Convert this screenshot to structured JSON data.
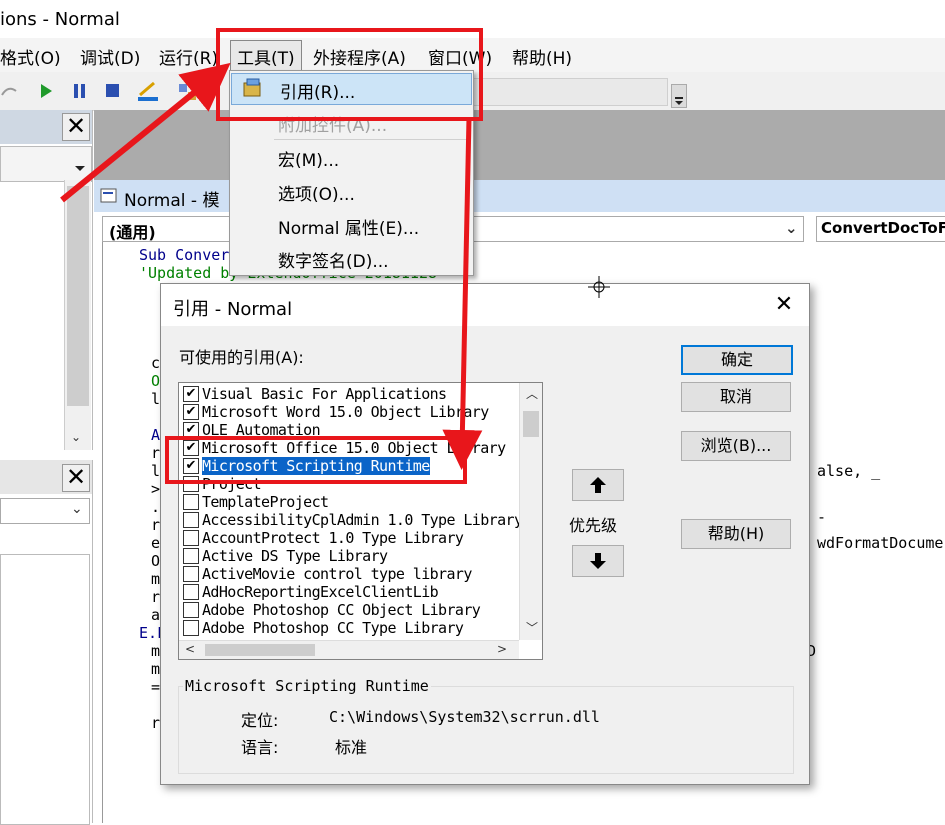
{
  "window": {
    "title": "ions - Normal"
  },
  "menubar": {
    "items": [
      "格式(O)",
      "调试(D)",
      "运行(R)",
      "工具(T)",
      "外接程序(A)",
      "窗口(W)",
      "帮助(H)"
    ]
  },
  "left_panes": {
    "top_close": "✕",
    "bottom_close": "✕"
  },
  "code_window": {
    "title": "Normal - 模",
    "left_combo": "(通用)",
    "right_combo": "ConvertDocToF",
    "lines": [
      "Sub Conver",
      "'Updated by ExtendOffice 20181128",
      "c",
      "O",
      "l",
      "A",
      "r",
      "l",
      ">",
      ".",
      "r",
      "e",
      "O",
      "m",
      "r",
      "a",
      "E.F",
      "m",
      "m",
      "=",
      "r"
    ],
    "right_fragments": [
      "alse, _",
      "-",
      "wdFormatDocumer",
      "D"
    ]
  },
  "tools_menu": {
    "items": [
      {
        "label": "引用(R)...",
        "state": "selected",
        "icon": "references-icon"
      },
      {
        "label": "附加控件(A)...",
        "state": "disabled"
      },
      {
        "label": "宏(M)...",
        "state": "normal"
      },
      {
        "label": "选项(O)...",
        "state": "normal"
      },
      {
        "label": "Normal 属性(E)...",
        "state": "normal"
      },
      {
        "label": "数字签名(D)...",
        "state": "normal"
      }
    ]
  },
  "references_dialog": {
    "title": "引用 - Normal",
    "close": "✕",
    "available_label": "可使用的引用(A):",
    "references": [
      {
        "name": "Visual Basic For Applications",
        "checked": true,
        "selected": false
      },
      {
        "name": "Microsoft Word 15.0 Object Library",
        "checked": true,
        "selected": false
      },
      {
        "name": "OLE Automation",
        "checked": true,
        "selected": false
      },
      {
        "name": "Microsoft Office 15.0 Object Library",
        "checked": true,
        "selected": false
      },
      {
        "name": "Microsoft Scripting Runtime",
        "checked": true,
        "selected": true
      },
      {
        "name": "Project",
        "checked": false,
        "selected": false
      },
      {
        "name": "TemplateProject",
        "checked": false,
        "selected": false
      },
      {
        "name": "AccessibilityCplAdmin 1.0 Type Library",
        "checked": false,
        "selected": false
      },
      {
        "name": "AccountProtect 1.0 Type Library",
        "checked": false,
        "selected": false
      },
      {
        "name": "Active DS Type Library",
        "checked": false,
        "selected": false
      },
      {
        "name": "ActiveMovie control type library",
        "checked": false,
        "selected": false
      },
      {
        "name": "AdHocReportingExcelClientLib",
        "checked": false,
        "selected": false
      },
      {
        "name": "Adobe Photoshop CC Object Library",
        "checked": false,
        "selected": false
      },
      {
        "name": "Adobe Photoshop CC Type Library",
        "checked": false,
        "selected": false
      }
    ],
    "buttons": {
      "ok": "确定",
      "cancel": "取消",
      "browse": "浏览(B)...",
      "help": "帮助(H)"
    },
    "priority_label": "优先级",
    "priority_up": "🡅",
    "priority_down": "🡇",
    "info": {
      "group_title": "Microsoft Scripting Runtime",
      "location_label": "定位:",
      "location_value": "C:\\Windows\\System32\\scrrun.dll",
      "language_label": "语言:",
      "language_value": "标准"
    }
  },
  "colors": {
    "annotation_red": "#e8161b",
    "selection_blue": "#0a64c8",
    "menu_highlight": "#cce4f7",
    "code_comment_green": "#008000",
    "code_keyword_blue": "#00008b"
  }
}
